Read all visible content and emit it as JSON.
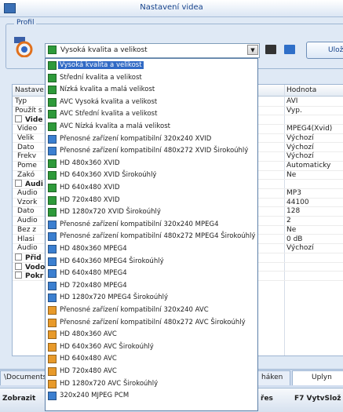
{
  "window": {
    "title": "Nastavení videa"
  },
  "profile": {
    "legend": "Profil",
    "selected": "Vysoká kvalita a velikost",
    "save_label": "Uložit"
  },
  "properties": {
    "header": [
      "Nastave",
      "Hodnota"
    ],
    "rows": [
      {
        "name": "Typ",
        "value": "AVI",
        "kind": "row"
      },
      {
        "name": "Použít s",
        "value": "Vyp.",
        "kind": "row"
      },
      {
        "name": "Vide",
        "value": "",
        "kind": "group"
      },
      {
        "name": "Video",
        "value": "MPEG4(Xvid)",
        "kind": "sub"
      },
      {
        "name": "Velik",
        "value": "Výchozí",
        "kind": "sub"
      },
      {
        "name": "Dato",
        "value": "Výchozí",
        "kind": "sub"
      },
      {
        "name": "Frekv",
        "value": "Výchozí",
        "kind": "sub"
      },
      {
        "name": "Pome",
        "value": "Automaticky",
        "kind": "sub"
      },
      {
        "name": "Zakó",
        "value": "Ne",
        "kind": "sub"
      },
      {
        "name": "Audi",
        "value": "",
        "kind": "group"
      },
      {
        "name": "Audio",
        "value": "MP3",
        "kind": "sub"
      },
      {
        "name": "Vzork",
        "value": "44100",
        "kind": "sub"
      },
      {
        "name": "Dato",
        "value": "128",
        "kind": "sub"
      },
      {
        "name": "Audio",
        "value": "2",
        "kind": "sub"
      },
      {
        "name": "Bez z",
        "value": "Ne",
        "kind": "sub"
      },
      {
        "name": "Hlasi",
        "value": "0 dB",
        "kind": "sub"
      },
      {
        "name": "Audio",
        "value": "Výchozí",
        "kind": "sub"
      },
      {
        "name": "Přid",
        "value": "",
        "kind": "group"
      },
      {
        "name": "Vodo",
        "value": "",
        "kind": "group"
      },
      {
        "name": "Pokr",
        "value": "",
        "kind": "group"
      }
    ]
  },
  "tabs": {
    "left": "\\Documents",
    "mid": "háken",
    "right": "Uplyn"
  },
  "function_bar": {
    "left": "Zobrazit",
    "mid": "řes",
    "right": "F7 VytvSlož"
  },
  "dropdown": {
    "options": [
      {
        "label": "Vysoká kvalita a velikost",
        "color": "#2e9a3a",
        "selected": true
      },
      {
        "label": "Střední kvalita a velikost",
        "color": "#2e9a3a"
      },
      {
        "label": "Nízká kvalita a malá velikost",
        "color": "#2e9a3a"
      },
      {
        "label": "AVC Vysoká kvalita a velikost",
        "color": "#2e9a3a"
      },
      {
        "label": "AVC Střední kvalita a velikost",
        "color": "#2e9a3a"
      },
      {
        "label": "AVC Nízká kvalita a malá velikost",
        "color": "#2e9a3a"
      },
      {
        "label": "Přenosné zařízení kompatibilní 320x240 XVID",
        "color": "#3b7fd0"
      },
      {
        "label": "Přenosné zařízení kompatibilní 480x272 XVID Širokoúhlý",
        "color": "#3b7fd0"
      },
      {
        "label": "HD 480x360 XVID",
        "color": "#2e9a3a"
      },
      {
        "label": "HD 640x360 XVID Širokoúhlý",
        "color": "#2e9a3a"
      },
      {
        "label": "HD 640x480 XVID",
        "color": "#2e9a3a"
      },
      {
        "label": "HD 720x480 XVID",
        "color": "#2e9a3a"
      },
      {
        "label": "HD 1280x720 XVID Širokoúhlý",
        "color": "#2e9a3a"
      },
      {
        "label": "Přenosné zařízení kompatibilní 320x240 MPEG4",
        "color": "#3b7fd0"
      },
      {
        "label": "Přenosné zařízení kompatibilní 480x272 MPEG4 Širokoúhlý",
        "color": "#3b7fd0"
      },
      {
        "label": "HD 480x360 MPEG4",
        "color": "#3b7fd0"
      },
      {
        "label": "HD 640x360 MPEG4 Širokoúhlý",
        "color": "#3b7fd0"
      },
      {
        "label": "HD 640x480 MPEG4",
        "color": "#3b7fd0"
      },
      {
        "label": "HD 720x480 MPEG4",
        "color": "#3b7fd0"
      },
      {
        "label": "HD 1280x720 MPEG4 Širokoúhlý",
        "color": "#3b7fd0"
      },
      {
        "label": "Přenosné zařízení kompatibilní 320x240 AVC",
        "color": "#e89a2a"
      },
      {
        "label": "Přenosné zařízení kompatibilní 480x272 AVC Širokoúhlý",
        "color": "#e89a2a"
      },
      {
        "label": "HD 480x360 AVC",
        "color": "#e89a2a"
      },
      {
        "label": "HD 640x360 AVC Širokoúhlý",
        "color": "#e89a2a"
      },
      {
        "label": "HD 640x480 AVC",
        "color": "#e89a2a"
      },
      {
        "label": "HD 720x480 AVC",
        "color": "#e89a2a"
      },
      {
        "label": "HD 1280x720 AVC Širokoúhlý",
        "color": "#e89a2a"
      },
      {
        "label": "320x240 MJPEG PCM",
        "color": "#3b7fd0"
      }
    ]
  }
}
